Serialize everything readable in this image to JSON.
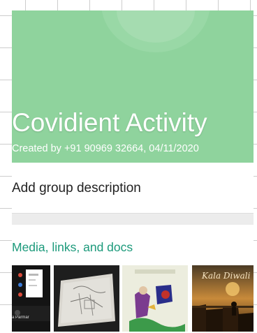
{
  "group": {
    "name": "Covidient Activity",
    "created_by": "Created by +91 90969 32664, 04/11/2020"
  },
  "description": {
    "placeholder": "Add group description"
  },
  "media": {
    "title": "Media, links, and docs",
    "thumbnails": [
      {
        "icon": "video-call-screenshot"
      },
      {
        "icon": "sketch-drawing-image"
      },
      {
        "icon": "painting-image"
      },
      {
        "icon": "poster-image",
        "caption": "Kala Diwali"
      }
    ],
    "t1_caption": "a Parmar"
  },
  "colors": {
    "header": "#8fd39d",
    "accent": "#1c9a7b"
  }
}
